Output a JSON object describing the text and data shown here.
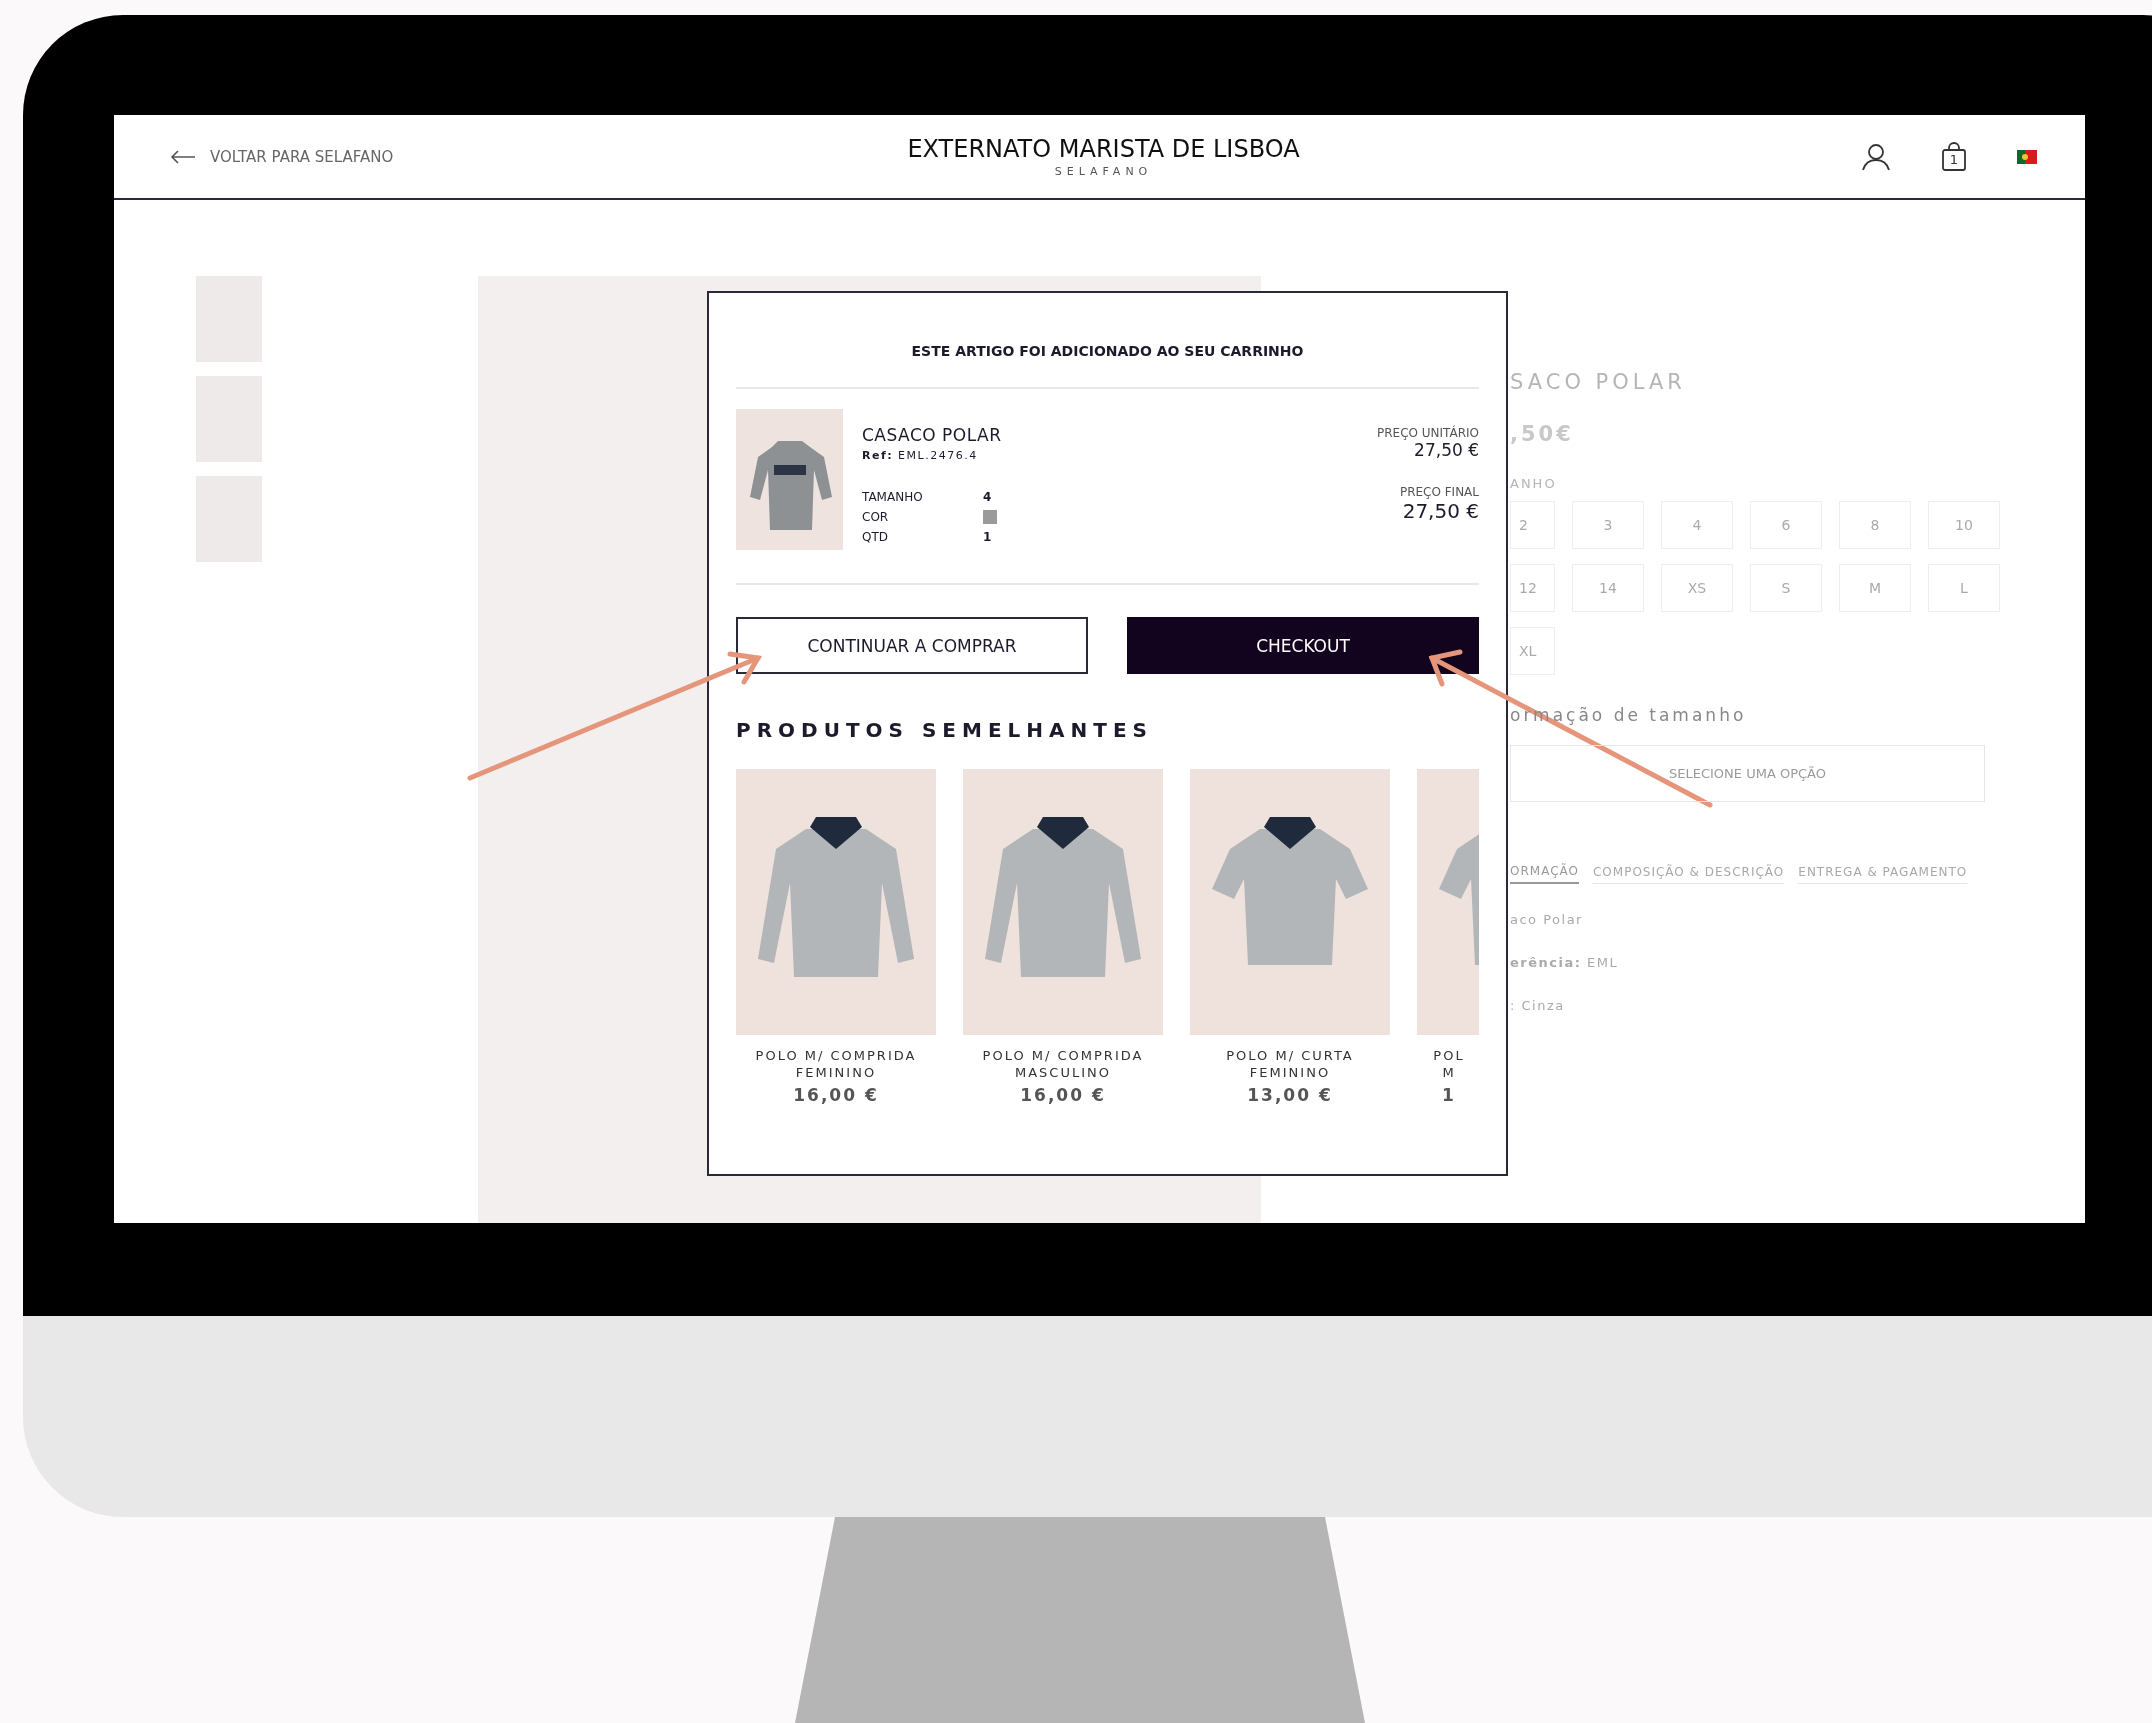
{
  "header": {
    "back_link": "VOLTAR PARA SELAFANO",
    "title": "EXTERNATO MARISTA DE LISBOA",
    "subtitle": "SELAFANO",
    "cart_count": "1"
  },
  "product_panel": {
    "title": "SACO POLAR",
    "price": ",50€",
    "size_label": "ANHO",
    "sizes": [
      "2",
      "3",
      "4",
      "6",
      "8",
      "10",
      "12",
      "14",
      "XS",
      "S",
      "M",
      "L",
      "XL"
    ],
    "size_info": "ormação de tamanho",
    "select": {
      "placeholder": "SELECIONE UMA OPÇÃO"
    },
    "tabs": [
      {
        "label": "ORMAÇÃO",
        "selected": true
      },
      {
        "label": "COMPOSIÇÃO & DESCRIÇÃO",
        "selected": false
      },
      {
        "label": "ENTREGA & PAGAMENTO",
        "selected": false
      }
    ],
    "details": [
      "aco Polar",
      "**erência:** EML",
      ": Cinza"
    ]
  },
  "modal": {
    "title": "ESTE ARTIGO FOI ADICIONADO AO SEU CARRINHO",
    "item": {
      "name": "CASACO POLAR",
      "ref": "**Ref:** EML.2476.4",
      "attributes": [
        {
          "label": "TAMANHO",
          "kind": "text",
          "value": "4"
        },
        {
          "label": "COR",
          "kind": "swatch",
          "color": "#9a9a9a"
        },
        {
          "label": "QTD",
          "kind": "text",
          "value": "1"
        }
      ],
      "unit_price_label": "PREÇO UNITÁRIO",
      "unit_price": "27,50 €",
      "final_price_label": "PREÇO FINAL",
      "final_price": "27,50 €"
    },
    "buttons": [
      {
        "label": "CONTINUAR A COMPRAR",
        "kind": "secondary"
      },
      {
        "label": "CHECKOUT",
        "kind": "primary"
      }
    ],
    "similar_title": "PRODUTOS SEMELHANTES",
    "similar": [
      {
        "name_lines": [
          "POLO M/ COMPRIDA",
          "FEMININO"
        ],
        "price": "16,00 €",
        "cut": false,
        "kind": "long-sleeve"
      },
      {
        "name_lines": [
          "POLO M/ COMPRIDA",
          "MASCULINO"
        ],
        "price": "16,00 €",
        "cut": false,
        "kind": "long-sleeve"
      },
      {
        "name_lines": [
          "POLO M/ CURTA",
          "FEMININO"
        ],
        "price": "13,00 €",
        "cut": false,
        "kind": "short-sleeve"
      },
      {
        "name_lines": [
          "POL",
          "M"
        ],
        "price": "1",
        "cut": true,
        "kind": "short-sleeve"
      }
    ]
  }
}
